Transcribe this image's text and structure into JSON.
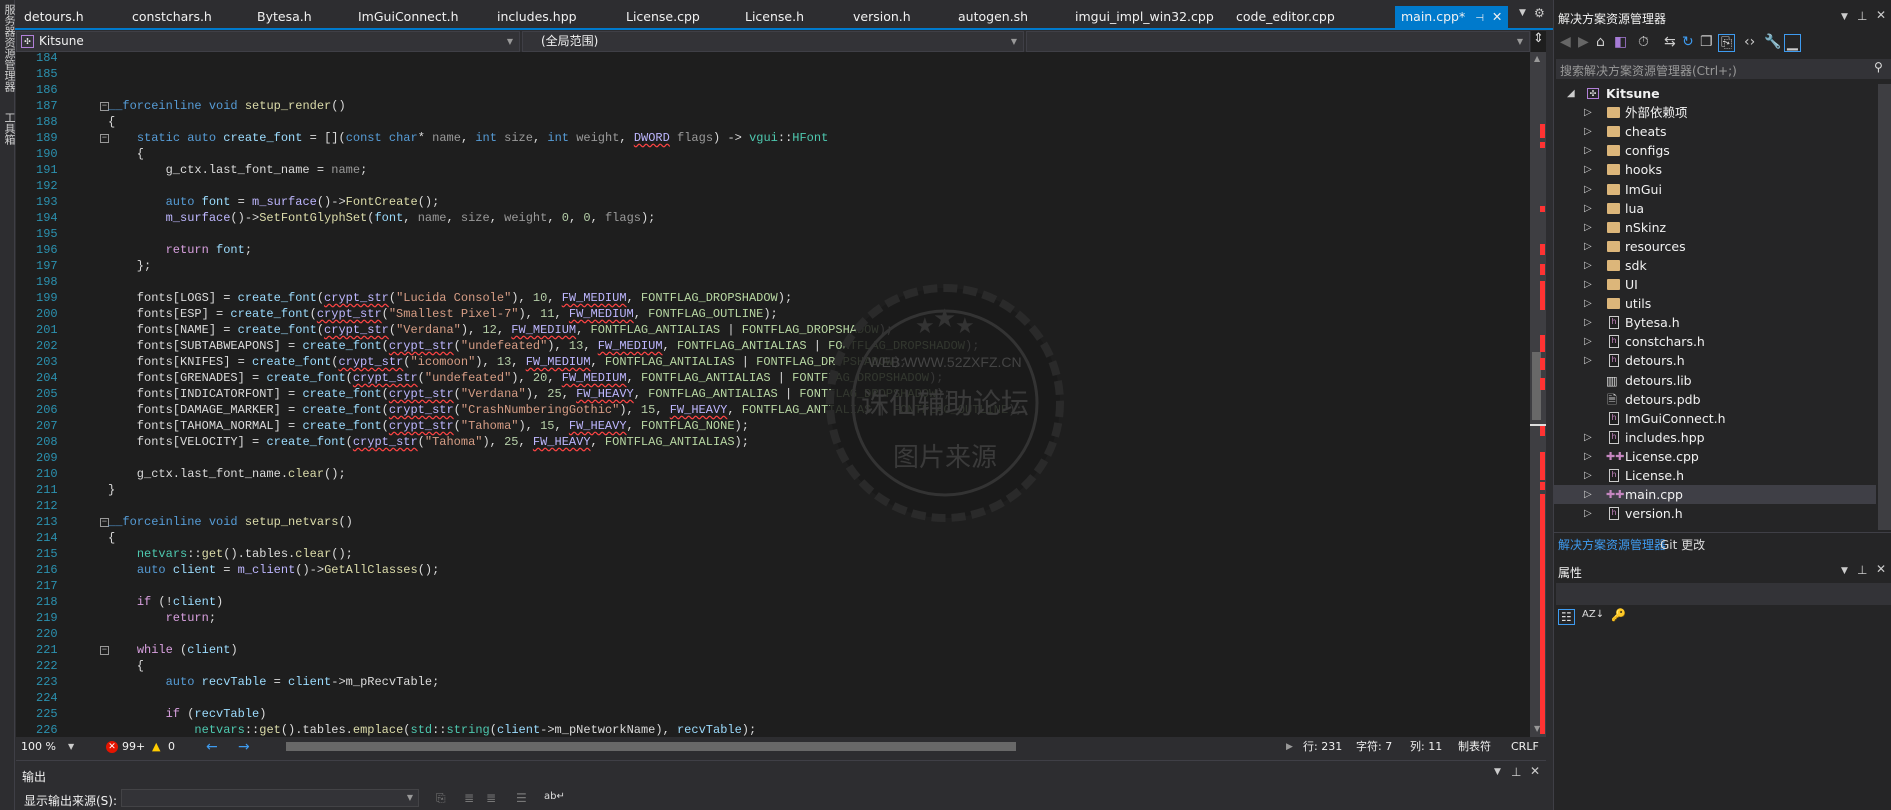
{
  "left_strip": {
    "server_explorer": "服务器资源管理器",
    "toolbox": "工具箱"
  },
  "tabs": [
    {
      "label": "detours.h"
    },
    {
      "label": "constchars.h"
    },
    {
      "label": "Bytesa.h"
    },
    {
      "label": "ImGuiConnect.h"
    },
    {
      "label": "includes.hpp"
    },
    {
      "label": "License.cpp"
    },
    {
      "label": "License.h"
    },
    {
      "label": "version.h"
    },
    {
      "label": "autogen.sh"
    },
    {
      "label": "imgui_impl_win32.cpp"
    },
    {
      "label": "code_editor.cpp"
    },
    {
      "label": "main.cpp*",
      "active": true
    }
  ],
  "navbar": {
    "project": "Kitsune",
    "scope": "(全局范围)",
    "member": ""
  },
  "editor": {
    "first_line": 184,
    "lines": [
      "",
      "",
      "",
      "__forceinline void setup_render()",
      "{",
      "    static auto create_font = [](const char* name, int size, int weight, DWORD flags) -> vgui::HFont",
      "    {",
      "        g_ctx.last_font_name = name;",
      "",
      "        auto font = m_surface()->FontCreate();",
      "        m_surface()->SetFontGlyphSet(font, name, size, weight, 0, 0, flags);",
      "",
      "        return font;",
      "    };",
      "",
      "    fonts[LOGS] = create_font(crypt_str(\"Lucida Console\"), 10, FW_MEDIUM, FONTFLAG_DROPSHADOW);",
      "    fonts[ESP] = create_font(crypt_str(\"Smallest Pixel-7\"), 11, FW_MEDIUM, FONTFLAG_OUTLINE);",
      "    fonts[NAME] = create_font(crypt_str(\"Verdana\"), 12, FW_MEDIUM, FONTFLAG_ANTIALIAS | FONTFLAG_DROPSHADOW);",
      "    fonts[SUBTABWEAPONS] = create_font(crypt_str(\"undefeated\"), 13, FW_MEDIUM, FONTFLAG_ANTIALIAS | FONTFLAG_DROPSHADOW);",
      "    fonts[KNIFES] = create_font(crypt_str(\"icomoon\"), 13, FW_MEDIUM, FONTFLAG_ANTIALIAS | FONTFLAG_DROPSHADOW);",
      "    fonts[GRENADES] = create_font(crypt_str(\"undefeated\"), 20, FW_MEDIUM, FONTFLAG_ANTIALIAS | FONTFLAG_DROPSHADOW);",
      "    fonts[INDICATORFONT] = create_font(crypt_str(\"Verdana\"), 25, FW_HEAVY, FONTFLAG_ANTIALIAS | FONTFLAG_DROPSHADOW);",
      "    fonts[DAMAGE_MARKER] = create_font(crypt_str(\"CrashNumberingGothic\"), 15, FW_HEAVY, FONTFLAG_ANTIALIAS | FONTFLAG_OUTLINE);",
      "    fonts[TAHOMA_NORMAL] = create_font(crypt_str(\"Tahoma\"), 15, FW_HEAVY, FONTFLAG_NONE);",
      "    fonts[VELOCITY] = create_font(crypt_str(\"Tahoma\"), 25, FW_HEAVY, FONTFLAG_ANTIALIAS);",
      "",
      "    g_ctx.last_font_name.clear();",
      "}",
      "",
      "__forceinline void setup_netvars()",
      "{",
      "    netvars::get().tables.clear();",
      "    auto client = m_client()->GetAllClasses();",
      "",
      "    if (!client)",
      "        return;",
      "",
      "    while (client)",
      "    {",
      "        auto recvTable = client->m_pRecvTable;",
      "",
      "        if (recvTable)",
      "            netvars::get().tables.emplace(std::string(client->m_pNetworkName), recvTable);"
    ],
    "fold_lines": [
      187,
      189,
      213,
      221
    ]
  },
  "watermark": {
    "url": "WEB:WWW.52ZXFZ.CN",
    "forum": "诛仙辅助论坛",
    "source": "图片来源"
  },
  "status": {
    "zoom": "100 %",
    "errors": "99+",
    "warnings": "0",
    "line": "行: 231",
    "char": "字符: 7",
    "col": "列: 11",
    "indent": "制表符",
    "eol": "CRLF"
  },
  "output": {
    "title": "输出",
    "source_label": "显示输出来源(S):",
    "source_value": ""
  },
  "solution_explorer": {
    "title": "解决方案资源管理器",
    "search_placeholder": "搜索解决方案资源管理器(Ctrl+;)",
    "root": "Kitsune",
    "items": [
      {
        "label": "外部依赖项",
        "type": "deps",
        "expandable": true
      },
      {
        "label": "cheats",
        "type": "folder",
        "expandable": true
      },
      {
        "label": "configs",
        "type": "folder",
        "expandable": true
      },
      {
        "label": "hooks",
        "type": "folder",
        "expandable": true
      },
      {
        "label": "ImGui",
        "type": "folder",
        "expandable": true
      },
      {
        "label": "lua",
        "type": "folder",
        "expandable": true
      },
      {
        "label": "nSkinz",
        "type": "folder",
        "expandable": true
      },
      {
        "label": "resources",
        "type": "folder",
        "expandable": true
      },
      {
        "label": "sdk",
        "type": "folder",
        "expandable": true
      },
      {
        "label": "UI",
        "type": "folder",
        "expandable": true
      },
      {
        "label": "utils",
        "type": "folder",
        "expandable": true
      },
      {
        "label": "Bytesa.h",
        "type": "h",
        "expandable": true
      },
      {
        "label": "constchars.h",
        "type": "h",
        "expandable": true
      },
      {
        "label": "detours.h",
        "type": "h",
        "expandable": true
      },
      {
        "label": "detours.lib",
        "type": "lib",
        "expandable": false
      },
      {
        "label": "detours.pdb",
        "type": "pdb",
        "expandable": false
      },
      {
        "label": "ImGuiConnect.h",
        "type": "h",
        "expandable": false
      },
      {
        "label": "includes.hpp",
        "type": "h",
        "expandable": true
      },
      {
        "label": "License.cpp",
        "type": "cpp",
        "expandable": true
      },
      {
        "label": "License.h",
        "type": "h",
        "expandable": true
      },
      {
        "label": "main.cpp",
        "type": "cpp",
        "expandable": true,
        "selected": true
      },
      {
        "label": "version.h",
        "type": "h",
        "expandable": true
      }
    ],
    "bottom_tabs": [
      "解决方案资源管理器",
      "Git 更改"
    ]
  },
  "properties": {
    "title": "属性"
  },
  "colors": {
    "accent": "#007acc",
    "error": "#e51400",
    "warning": "#ffcc00"
  }
}
